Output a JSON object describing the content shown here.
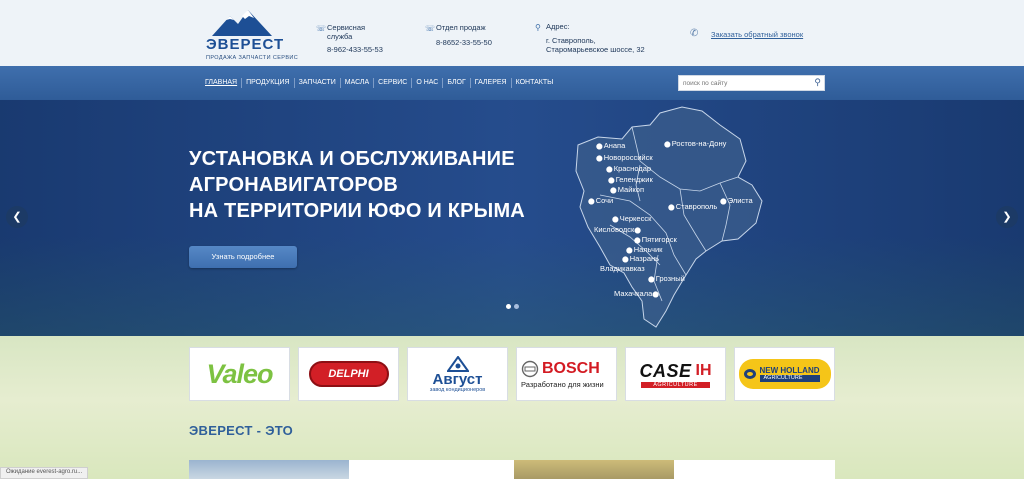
{
  "header": {
    "logo_word": "ЭВЕРЕСТ",
    "logo_sub": "ПРОДАЖА ЗАПЧАСТИ СЕРВИС",
    "service": {
      "title": "Сервисная служба",
      "phone": "8-962-433-55-53"
    },
    "sales": {
      "title": "Отдел продаж",
      "phone": "8-8652-33-55-50"
    },
    "address": {
      "title": "Адрес:",
      "line1": "г. Ставрополь,",
      "line2": "Старомарьевское шоссе, 32"
    },
    "callback": "Заказать обратный звонок"
  },
  "nav": {
    "items": [
      "ГЛАВНАЯ",
      "ПРОДУКЦИЯ",
      "ЗАПЧАСТИ",
      "МАСЛА",
      "СЕРВИС",
      "О НАС",
      "БЛОГ",
      "ГАЛЕРЕЯ",
      "КОНТАКТЫ"
    ],
    "search_placeholder": "поиск по сайту"
  },
  "hero": {
    "title_line1": "УСТАНОВКА И ОБСЛУЖИВАНИЕ",
    "title_line2": "АГРОНАВИГАТОРОВ",
    "title_line3": "НА ТЕРРИТОРИИ ЮФО И КРЫМА",
    "button": "Узнать подробнее",
    "slides": 2,
    "active_slide": 1,
    "cities": [
      "Анапа",
      "Ростов-на-Дону",
      "Новороссийск",
      "Краснодар",
      "Геленджик",
      "Майкоп",
      "Сочи",
      "Элиста",
      "Ставрополь",
      "Черкесск",
      "Кисловодск",
      "Пятигорск",
      "Нальчик",
      "Назрань",
      "Владикавказ",
      "Грозный",
      "Махачкала"
    ]
  },
  "brands": {
    "valeo": "Valeo",
    "delphi": "DELPHI",
    "avgust": "Август",
    "avgust_sub": "завод кондиционеров",
    "bosch": "BOSCH",
    "bosch_sub": "Разработано для жизни",
    "case": "CASE",
    "case_mark": "IH",
    "case_sub": "AGRICULTURE",
    "nh": "NEW HOLLAND",
    "nh_sub": "AGRICULTURE"
  },
  "section": {
    "title": "ЭВЕРЕСТ - ЭТО"
  },
  "status_bar": "Ожидание everest-agro.ru..."
}
